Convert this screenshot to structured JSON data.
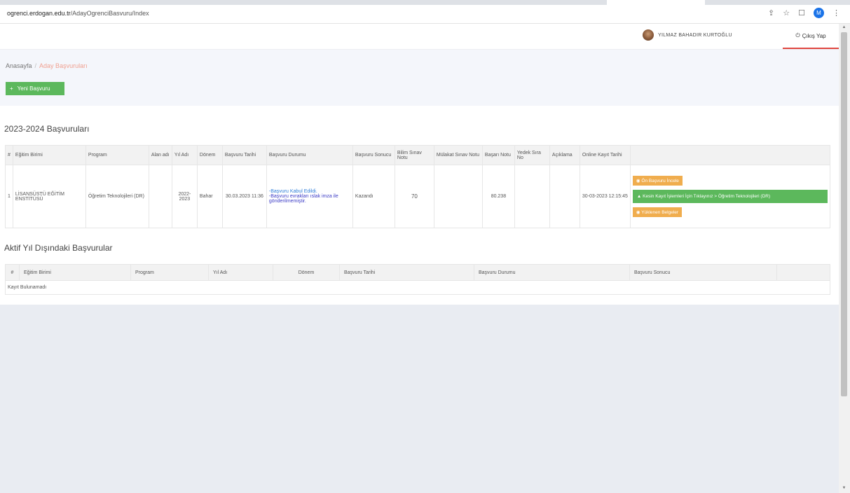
{
  "browser": {
    "url_domain": "ogrenci.erdogan.edu.tr",
    "url_path": "/AdayOgrenciBasvuru/Index",
    "profile_initial": "M"
  },
  "header": {
    "user_name": "YILMAZ BAHADIR KURTOĞLU",
    "logout_label": "Çıkış Yap"
  },
  "breadcrumb": {
    "home": "Anasayfa",
    "separator": "/",
    "current": "Aday Başvuruları"
  },
  "new_application_label": "Yeni Başvuru",
  "current_applications": {
    "title": "2023-2024 Başvuruları",
    "headers": [
      "#",
      "Eğitim Birimi",
      "Program",
      "Alan adı",
      "Yıl Adı",
      "Dönem",
      "Başvuru Tarihi",
      "Başvuru Durumu",
      "Başvuru Sonucu",
      "Bilim Sınav Notu",
      "Mülakat Sınav Notu",
      "Başarı Notu",
      "Yedek Sıra No",
      "Açıklama",
      "Online Kayıt Tarihi",
      ""
    ],
    "row": {
      "no": "1",
      "unit": "LİSANSÜSTÜ EĞİTİM ENSTİTÜSÜ",
      "program": "Öğretim Teknolojileri (DR)",
      "field": "",
      "year": "2022-2023",
      "term": "Bahar",
      "date": "30.03.2023 11:36",
      "status_1": "-Başvuru Kabul Edildi.",
      "status_2": "-Başvuru evrakları ıslak imza ile gönderilmemiştir.",
      "result": "Kazandı",
      "exam_score": "70",
      "interview_score": "",
      "success_score": "80.238",
      "reserve_no": "",
      "note": "",
      "online_date": "30-03-2023 12:15:45",
      "btn_preview": "Ön Başvuru İncele",
      "btn_register": "Kesin Kayıt İşlemleri İçin Tıklayınız > Öğretim Teknolojileri (DR)",
      "btn_uploaded": "Yüklenen Belgeler"
    }
  },
  "other_applications": {
    "title": "Aktif Yıl Dışındaki Başvurular",
    "headers": [
      "#",
      "Eğitim Birimi",
      "Program",
      "Yıl Adı",
      "Dönem",
      "Başvuru Tarihi",
      "Başvuru Durumu",
      "Başvuru Sonucu",
      ""
    ],
    "empty_message": "Kayıt Bulunamadı"
  },
  "colors": {
    "success": "#5cb85c",
    "warning": "#f0ad4e",
    "link": "#2f7ed8",
    "logout_underline": "#e0463f"
  }
}
